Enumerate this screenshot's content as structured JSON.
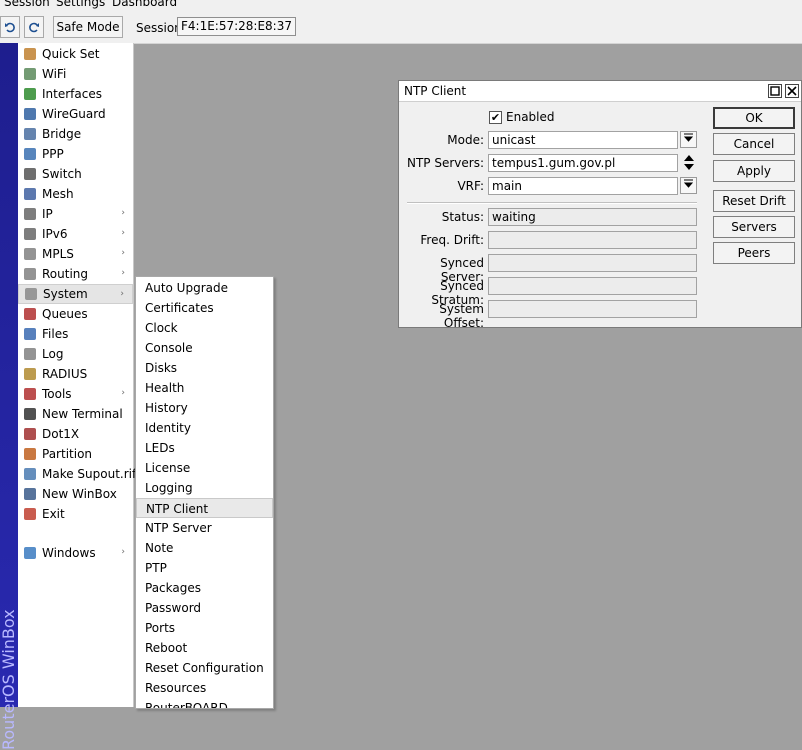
{
  "menubar": {
    "session": "Session",
    "settings": "Settings",
    "dashboard": "Dashboard"
  },
  "toolbar": {
    "undo_icon": "undo-icon",
    "redo_icon": "redo-icon",
    "safe_mode": "Safe Mode",
    "session_label": "Session:",
    "session_value": "F4:1E:57:28:E8:37"
  },
  "brand": "RouterOS WinBox",
  "sidebar": {
    "items": [
      {
        "label": "Quick Set",
        "icon": "wand-icon",
        "color": "#c08030"
      },
      {
        "label": "WiFi",
        "icon": "wifi-icon",
        "color": "#5a8a5a"
      },
      {
        "label": "Interfaces",
        "icon": "interfaces-icon",
        "color": "#2e8b2e"
      },
      {
        "label": "WireGuard",
        "icon": "wireguard-icon",
        "color": "#3060a0"
      },
      {
        "label": "Bridge",
        "icon": "bridge-icon",
        "color": "#4a6ea0"
      },
      {
        "label": "PPP",
        "icon": "ppp-icon",
        "color": "#3a70b0"
      },
      {
        "label": "Switch",
        "icon": "switch-icon",
        "color": "#555555"
      },
      {
        "label": "Mesh",
        "icon": "mesh-icon",
        "color": "#4060a0"
      },
      {
        "label": "IP",
        "icon": "ip-icon",
        "color": "#666666",
        "arrow": "›"
      },
      {
        "label": "IPv6",
        "icon": "ipv6-icon",
        "color": "#666666",
        "arrow": "›"
      },
      {
        "label": "MPLS",
        "icon": "mpls-icon",
        "color": "#808080",
        "arrow": "›"
      },
      {
        "label": "Routing",
        "icon": "routing-icon",
        "color": "#808080",
        "arrow": "›"
      },
      {
        "label": "System",
        "icon": "gear-icon",
        "color": "#8a8a8a",
        "arrow": "›"
      },
      {
        "label": "Queues",
        "icon": "queues-icon",
        "color": "#b03030"
      },
      {
        "label": "Files",
        "icon": "files-icon",
        "color": "#3a6ab0"
      },
      {
        "label": "Log",
        "icon": "log-icon",
        "color": "#808080"
      },
      {
        "label": "RADIUS",
        "icon": "radius-icon",
        "color": "#b08a30"
      },
      {
        "label": "Tools",
        "icon": "tools-icon",
        "color": "#b03030",
        "arrow": "›"
      },
      {
        "label": "New Terminal",
        "icon": "terminal-icon",
        "color": "#333333"
      },
      {
        "label": "Dot1X",
        "icon": "dot1x-icon",
        "color": "#a03030"
      },
      {
        "label": "Partition",
        "icon": "partition-icon",
        "color": "#c06020"
      },
      {
        "label": "Make Supout.rif",
        "icon": "supout-icon",
        "color": "#4a7ab0"
      },
      {
        "label": "New WinBox",
        "icon": "winbox-icon",
        "color": "#3a5a8a"
      },
      {
        "label": "Exit",
        "icon": "exit-icon",
        "color": "#c04030"
      },
      {
        "label": "Windows",
        "icon": "windows-icon",
        "color": "#3a7ac0",
        "arrow": "›"
      }
    ]
  },
  "system_submenu": [
    "Auto Upgrade",
    "Certificates",
    "Clock",
    "Console",
    "Disks",
    "Health",
    "History",
    "Identity",
    "LEDs",
    "License",
    "Logging",
    "NTP Client",
    "NTP Server",
    "Note",
    "PTP",
    "Packages",
    "Password",
    "Ports",
    "Reboot",
    "Reset Configuration",
    "Resources",
    "RouterBOARD"
  ],
  "ntp": {
    "title": "NTP Client",
    "enabled_label": "Enabled",
    "enabled": true,
    "mode_label": "Mode:",
    "mode_value": "unicast",
    "servers_label": "NTP Servers:",
    "servers_value": "tempus1.gum.gov.pl",
    "vrf_label": "VRF:",
    "vrf_value": "main",
    "status_label": "Status:",
    "status_value": "waiting",
    "drift_label": "Freq. Drift:",
    "drift_value": "",
    "synced_server_label": "Synced Server:",
    "synced_server_value": "",
    "synced_stratum_label": "Synced Stratum:",
    "synced_stratum_value": "",
    "offset_label": "System Offset:",
    "offset_value": "",
    "buttons": {
      "ok": "OK",
      "cancel": "Cancel",
      "apply": "Apply",
      "reset_drift": "Reset Drift",
      "servers": "Servers",
      "peers": "Peers"
    }
  }
}
